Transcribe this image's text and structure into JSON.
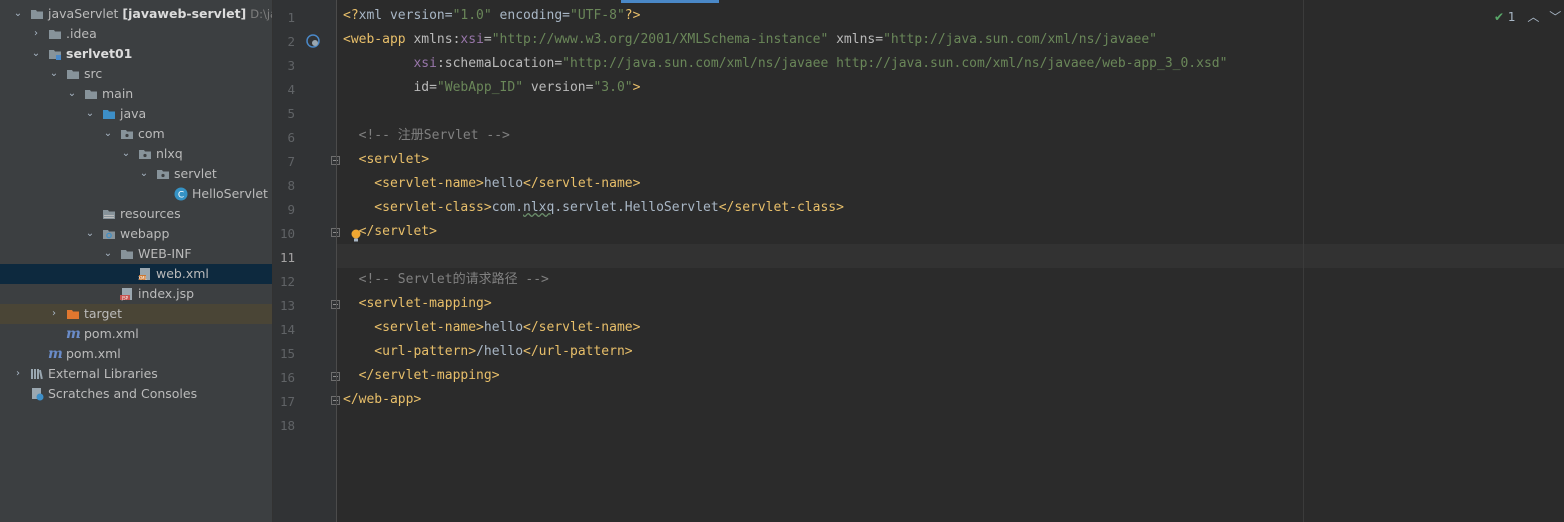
{
  "project_tree": {
    "root": {
      "name": "javaServlet",
      "module": "[javaweb-servlet]",
      "path_hint": "D:\\javaR"
    },
    "rows": [
      {
        "label": "javaServlet [javaweb-servlet]"
      },
      {
        "label": ".idea"
      },
      {
        "label": "serlvet01"
      },
      {
        "label": "src"
      },
      {
        "label": "main"
      },
      {
        "label": "java"
      },
      {
        "label": "com"
      },
      {
        "label": "nlxq"
      },
      {
        "label": "servlet"
      },
      {
        "label": "HelloServlet"
      },
      {
        "label": "resources"
      },
      {
        "label": "webapp"
      },
      {
        "label": "WEB-INF"
      },
      {
        "label": "web.xml"
      },
      {
        "label": "index.jsp"
      },
      {
        "label": "target"
      },
      {
        "label": "pom.xml"
      },
      {
        "label": "pom.xml"
      },
      {
        "label": "External Libraries"
      },
      {
        "label": "Scratches and Consoles"
      }
    ]
  },
  "editor": {
    "line_numbers": [
      "1",
      "2",
      "3",
      "4",
      "5",
      "6",
      "7",
      "8",
      "9",
      "10",
      "11",
      "12",
      "13",
      "14",
      "15",
      "16",
      "17",
      "18"
    ],
    "current_line": "11",
    "inspection_count": "1",
    "lines": [
      "<?xml version=\"1.0\" encoding=\"UTF-8\"?>",
      "<web-app xmlns:xsi=\"http://www.w3.org/2001/XMLSchema-instance\" xmlns=\"http://java.sun.com/xml/ns/javaee\"",
      "         xsi:schemaLocation=\"http://java.sun.com/xml/ns/javaee http://java.sun.com/xml/ns/javaee/web-app_3_0.xsd\"",
      "         id=\"WebApp_ID\" version=\"3.0\">",
      "",
      "  <!-- 注册Servlet -->",
      "  <servlet>",
      "    <servlet-name>hello</servlet-name>",
      "    <servlet-class>com.nlxq.servlet.HelloServlet</servlet-class>",
      "  </servlet>",
      "",
      "  <!-- Servlet的请求路径 -->",
      "  <servlet-mapping>",
      "    <servlet-name>hello</servlet-name>",
      "    <url-pattern>/hello</url-pattern>",
      "  </servlet-mapping>",
      "</web-app>",
      ""
    ]
  },
  "colors": {
    "background": "#2b2b2b",
    "sidebar": "#3c3f41",
    "tag": "#e8bf6a",
    "string": "#6a8759",
    "comment": "#808080",
    "namespace": "#9876aa"
  },
  "icons": [
    "chevron-down-icon",
    "chevron-right-icon",
    "folder-icon",
    "java-class-icon",
    "xml-file-icon",
    "jsp-file-icon",
    "maven-pom-icon",
    "libraries-icon",
    "scratches-icon",
    "checkmark-icon"
  ]
}
